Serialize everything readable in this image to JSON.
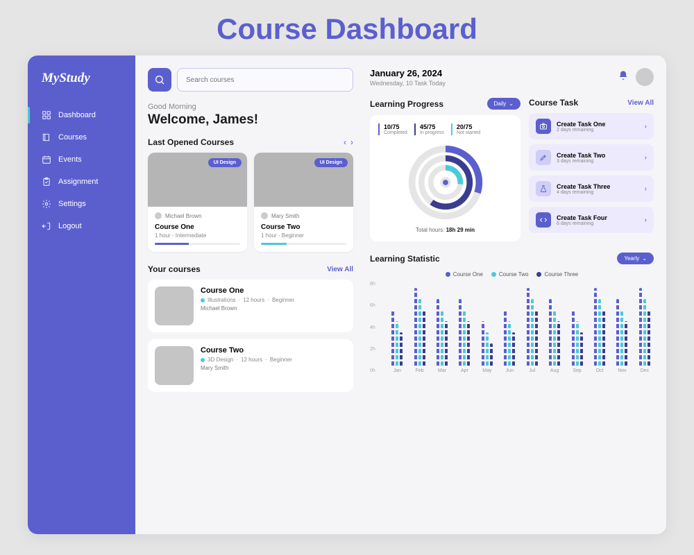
{
  "page_heading": "Course Dashboard",
  "logo": "MyStudy",
  "nav": [
    {
      "label": "Dashboard",
      "icon": "grid"
    },
    {
      "label": "Courses",
      "icon": "book"
    },
    {
      "label": "Events",
      "icon": "calendar"
    },
    {
      "label": "Assignment",
      "icon": "clipboard"
    },
    {
      "label": "Settings",
      "icon": "gear"
    },
    {
      "label": "Logout",
      "icon": "logout"
    }
  ],
  "search": {
    "placeholder": "Search courses"
  },
  "greeting": "Good Morning",
  "welcome": "Welcome, James!",
  "last_opened": {
    "title": "Last Opened Courses",
    "cards": [
      {
        "tag": "UI Design",
        "author": "Michael Brown",
        "title": "Course One",
        "meta": "1 hour - Intermediate",
        "progress": 40
      },
      {
        "tag": "UI Design",
        "author": "Mary Smith",
        "title": "Course Two",
        "meta": "1 hour - Beginner",
        "progress": 30
      }
    ]
  },
  "your_courses": {
    "title": "Your courses",
    "view_all": "View All",
    "items": [
      {
        "title": "Course One",
        "category": "Illustrations",
        "hours": "12 hours",
        "level": "Beginner",
        "author": "Michael Brown"
      },
      {
        "title": "Course Two",
        "category": "3D Design",
        "hours": "12 hours",
        "level": "Beginner",
        "author": "Mary Smith"
      }
    ]
  },
  "header": {
    "date": "January 26, 2024",
    "subtitle": "Wednesday, 10 Task Today"
  },
  "learning_progress": {
    "title": "Learning Progress",
    "filter": "Daily",
    "stats": [
      {
        "num": "10/75",
        "label": "Completed"
      },
      {
        "num": "45/75",
        "label": "In progress"
      },
      {
        "num": "20/75",
        "label": "Not started"
      }
    ],
    "total_label": "Total hours:",
    "total_value": "18h 29 min"
  },
  "course_task": {
    "title": "Course Task",
    "view_all": "View All",
    "items": [
      {
        "title": "Create Task One",
        "sub": "2 days remaining"
      },
      {
        "title": "Create Task Two",
        "sub": "3 days remaining"
      },
      {
        "title": "Create Task Three",
        "sub": "4 days remaining"
      },
      {
        "title": "Create Task Four",
        "sub": "6 days remaining"
      }
    ]
  },
  "learning_stat": {
    "title": "Learning Statistic",
    "filter": "Yearly",
    "legend": [
      "Course One",
      "Course Two",
      "Course Three"
    ]
  },
  "chart_data": {
    "type": "bar",
    "categories": [
      "Jan",
      "Feb",
      "Mar",
      "Apr",
      "May",
      "Jun",
      "Jul",
      "Aug",
      "Sep",
      "Oct",
      "Nov",
      "Dec"
    ],
    "series": [
      {
        "name": "Course One",
        "values": [
          5,
          7,
          6,
          6,
          4,
          5,
          7,
          6,
          5,
          7,
          6,
          7
        ],
        "color": "#5b5fce"
      },
      {
        "name": "Course Two",
        "values": [
          4,
          6,
          5,
          5,
          3,
          4,
          6,
          5,
          4,
          6,
          5,
          6
        ],
        "color": "#4bc9d9"
      },
      {
        "name": "Course Three",
        "values": [
          3,
          5,
          4,
          4,
          2,
          3,
          5,
          4,
          3,
          5,
          4,
          5
        ],
        "color": "#3a3d8f"
      }
    ],
    "ylabel": "hours",
    "ylim": [
      0,
      8
    ],
    "yticks": [
      "0h",
      "2h",
      "4h",
      "6h",
      "8h"
    ]
  },
  "colors": {
    "primary": "#5b5fce",
    "cyan": "#4bc9d9",
    "dark": "#3a3d8f"
  }
}
